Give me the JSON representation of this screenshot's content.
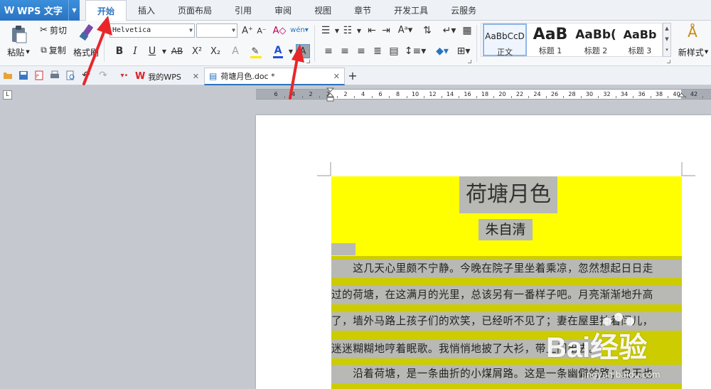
{
  "app": {
    "logo": "W",
    "name": "WPS 文字"
  },
  "menu": {
    "tabs": [
      "开始",
      "插入",
      "页面布局",
      "引用",
      "审阅",
      "视图",
      "章节",
      "开发工具",
      "云服务"
    ]
  },
  "ribbon": {
    "paste": "粘贴",
    "cut": "剪切",
    "copy": "复制",
    "format_painter": "格式刷",
    "font_name": "Helvetica",
    "font_size": "",
    "bold": "B",
    "italic": "I",
    "underline": "U",
    "strike": "AB",
    "superscript": "X²",
    "subscript": "X₂",
    "font_color": "A",
    "highlight": "A",
    "styles": [
      {
        "preview": "AaBbCcD",
        "label": "正文"
      },
      {
        "preview": "AaB",
        "label": "标题 1"
      },
      {
        "preview": "AaBb(",
        "label": "标题 2"
      },
      {
        "preview": "AaBb",
        "label": "标题 3"
      }
    ],
    "new_style": "新样式"
  },
  "doc_tabs": [
    {
      "label": "我的WPS"
    },
    {
      "label": "荷塘月色.doc *"
    }
  ],
  "ruler": {
    "labels": [
      "6",
      "4",
      "2",
      "2",
      "2",
      "4",
      "6",
      "8",
      "10",
      "12",
      "14",
      "16",
      "18",
      "20",
      "22",
      "24",
      "26",
      "28",
      "30",
      "32",
      "34",
      "36",
      "38",
      "40",
      "42"
    ]
  },
  "document": {
    "title": "荷塘月色",
    "author": "朱自清",
    "lines": [
      "　　这几天心里颇不宁静。今晚在院子里坐着乘凉，忽然想起日日走",
      "过的荷塘，在这满月的光里，总该另有一番样子吧。月亮渐渐地升高",
      "了，墙外马路上孩子们的欢笑，已经听不见了；妻在屋里拍着闰儿，",
      "迷迷糊糊地哼着眠歌。我悄悄地披了大衫，带上门出去。",
      "　　沿着荷塘，是一条曲折的小煤屑路。这是一条幽僻的路；白天也"
    ]
  },
  "watermark": {
    "brand": "Bai经验",
    "url": "jingyan.baidu.com"
  },
  "colors": {
    "accent": "#2a73c2",
    "highlight_yellow": "#ffff00",
    "shade_gray": "#b8b9b4",
    "arrow_red": "#e8262a"
  }
}
